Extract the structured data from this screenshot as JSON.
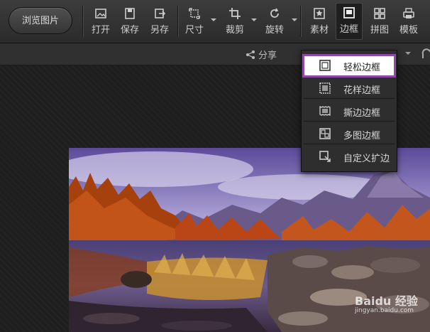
{
  "toolbar": {
    "browse_label": "浏览图片",
    "items": [
      {
        "label": "打开",
        "icon": "open-image-icon"
      },
      {
        "label": "保存",
        "icon": "save-icon"
      },
      {
        "label": "另存",
        "icon": "save-as-icon"
      },
      {
        "label": "尺寸",
        "icon": "resize-icon"
      },
      {
        "label": "裁剪",
        "icon": "crop-icon"
      },
      {
        "label": "旋转",
        "icon": "rotate-icon"
      },
      {
        "label": "素材",
        "icon": "material-star-icon"
      },
      {
        "label": "边框",
        "icon": "frame-icon"
      },
      {
        "label": "拼图",
        "icon": "puzzle-grid-icon"
      },
      {
        "label": "模板",
        "icon": "template-printer-icon"
      }
    ],
    "active_item": "边框"
  },
  "subbar": {
    "share_label": "分享"
  },
  "frame_menu": {
    "items": [
      {
        "label": "轻松边框",
        "icon": "simple-frame-icon",
        "selected": true
      },
      {
        "label": "花样边框",
        "icon": "pattern-frame-icon"
      },
      {
        "label": "撕边边框",
        "icon": "torn-edge-frame-icon"
      },
      {
        "label": "多图边框",
        "icon": "multi-image-frame-icon"
      },
      {
        "label": "自定义扩边",
        "icon": "custom-expand-icon"
      }
    ],
    "highlight_color": "#8e4aa8"
  },
  "watermark": {
    "text": "Baidu 经验",
    "sub": "jingyan.baidu.com"
  }
}
